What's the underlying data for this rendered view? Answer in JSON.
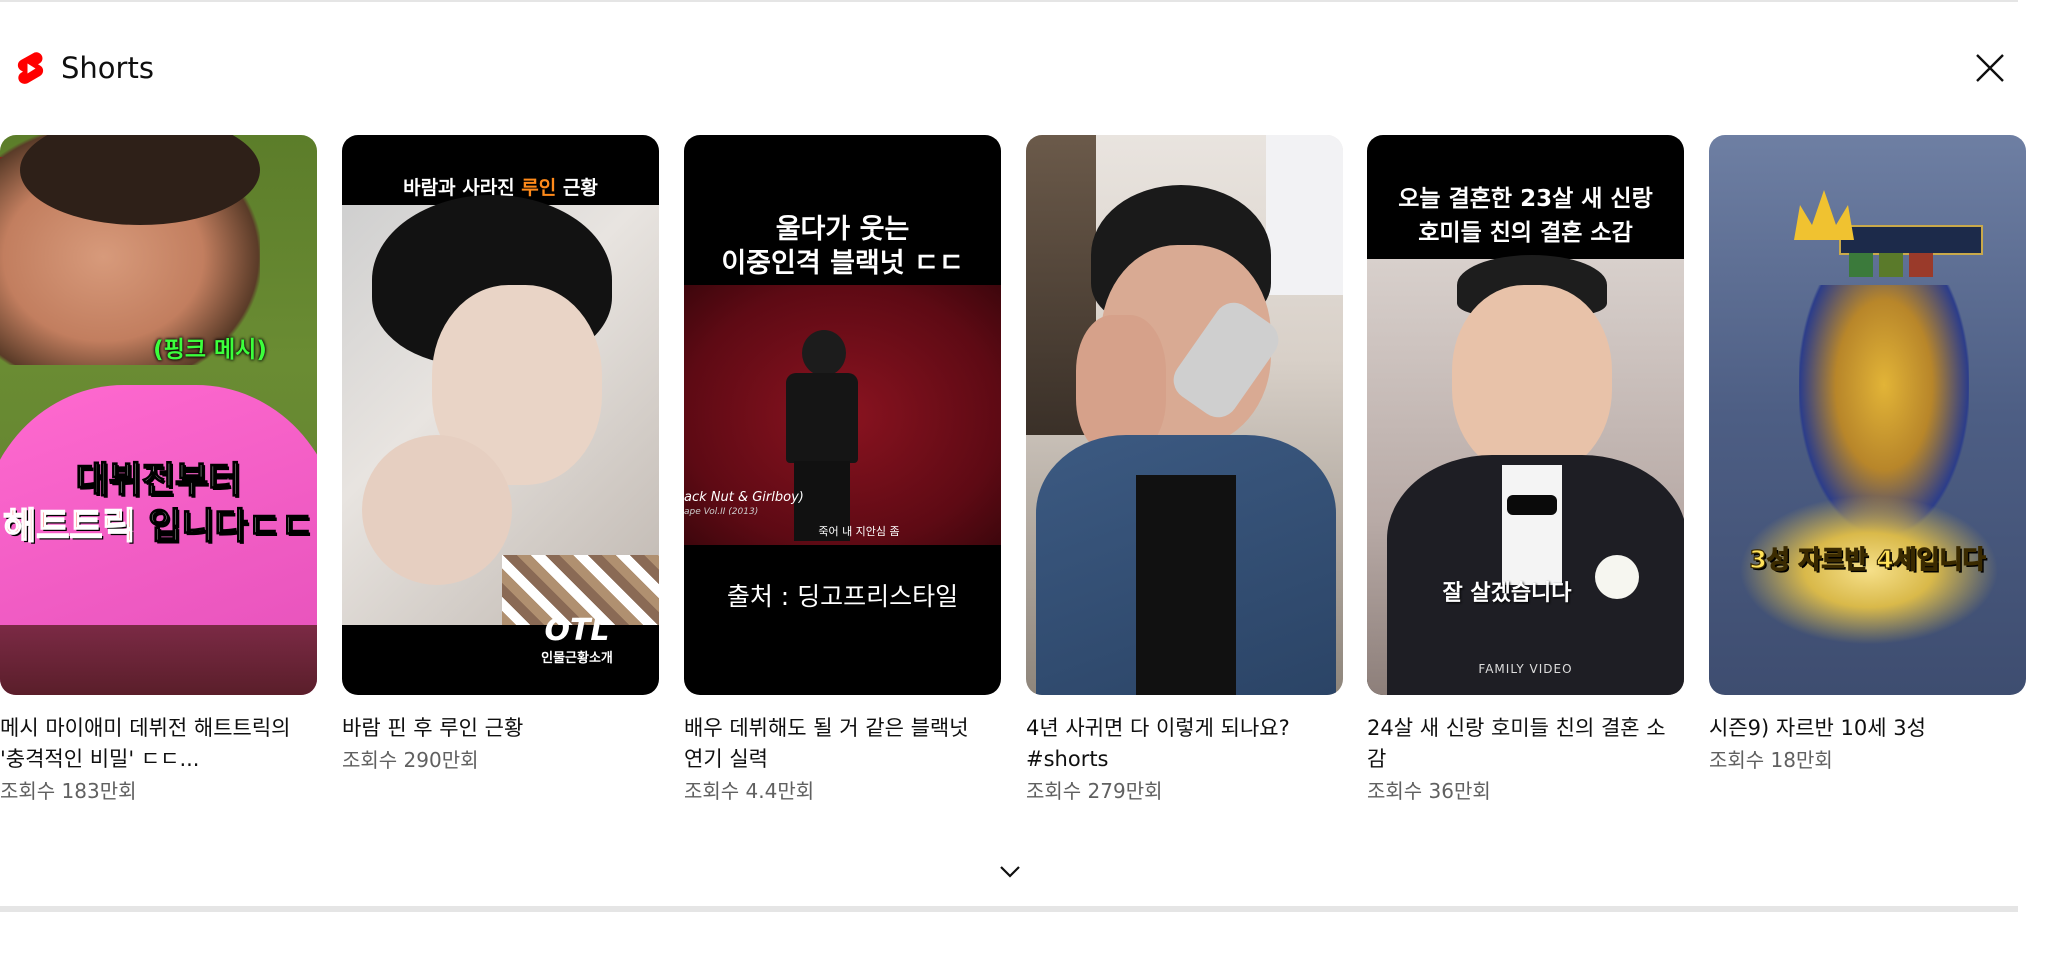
{
  "shelf": {
    "title": "Shorts",
    "icon": "youtube-shorts-icon",
    "brand_color": "#ff0000",
    "close_icon": "close-icon",
    "expand_icon": "chevron-down-icon"
  },
  "items": [
    {
      "title": "메시 마이애미 데뷔전 해트트릭의 '충격적인 비밀' ㄷㄷ...",
      "views": "조회수 183만회",
      "overlay": {
        "line1": "(핑크 메시)",
        "line2": "대뷔전부터",
        "line3a": "해트트릭",
        "line3b": "입니다ㄷㄷ"
      }
    },
    {
      "title": "바람 핀 후 루인 근황",
      "views": "조회수 290만회",
      "overlay": {
        "top_a": "바람과 사라진 ",
        "top_b": "루인",
        "top_c": " 근황",
        "bottom_a": "OTL",
        "bottom_b": "인물근황소개"
      }
    },
    {
      "title": "배우 데뷔해도 될 거 같은 블랙넛 연기 실력",
      "views": "조회수 4.4만회",
      "overlay": {
        "top1": "울다가 웃는",
        "top2": "이중인격 블랙넛 ㄷㄷ",
        "mid_left": "ack Nut & Girlboy)",
        "mid_left2": "ape Vol.II (2013)",
        "mid_sub": "죽어 내 지안심 좀",
        "bottom": "출처 : 딩고프리스타일"
      }
    },
    {
      "title": "4년 사귀면 다 이렇게 되나요? #shorts",
      "views": "조회수 279만회",
      "overlay": {}
    },
    {
      "title": "24살 새 신랑 호미들 친의 결혼 소감",
      "views": "조회수 36만회",
      "overlay": {
        "top1": "오늘 결혼한 23살 새 신랑",
        "top2": "호미들 친의 결혼 소감",
        "caption": "잘 살겠습니다",
        "watermark": "FAMILY VIDEO"
      }
    },
    {
      "title": "시즌9) 자르반 10세 3성",
      "views": "조회수 18만회",
      "overlay": {
        "caption": "3성 자르반 4세입니다"
      }
    }
  ]
}
